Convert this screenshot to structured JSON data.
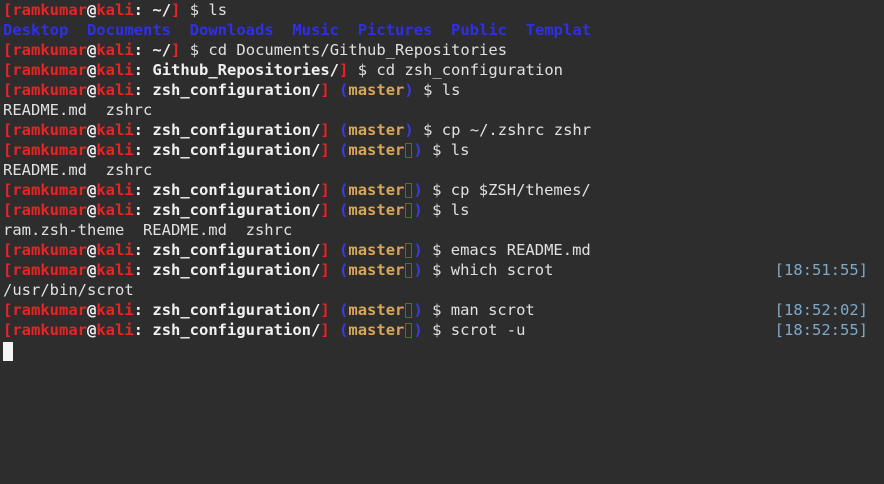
{
  "prompt": {
    "user": "ramkumar",
    "at": "@",
    "host": "kali",
    "colon": ":",
    "open_bracket": "[",
    "close_bracket": "]",
    "dollar": "$"
  },
  "lines": [
    {
      "type": "prompt",
      "path": "~/",
      "branch": "",
      "dirty": false,
      "command": "ls",
      "timestamp": ""
    },
    {
      "type": "dirs",
      "items": [
        "Desktop",
        "Documents",
        "Downloads",
        "Music",
        "Pictures",
        "Public",
        "Templat"
      ]
    },
    {
      "type": "prompt",
      "path": "~/",
      "branch": "",
      "dirty": false,
      "command": "cd Documents/Github_Repositories",
      "timestamp": ""
    },
    {
      "type": "prompt",
      "path": "Github_Repositories/",
      "branch": "",
      "dirty": false,
      "command": "cd zsh_configuration",
      "timestamp": ""
    },
    {
      "type": "prompt",
      "path": "zsh_configuration/",
      "branch": "master",
      "dirty": false,
      "command": "ls",
      "timestamp": ""
    },
    {
      "type": "output",
      "text": "README.md  zshrc"
    },
    {
      "type": "prompt",
      "path": "zsh_configuration/",
      "branch": "master",
      "dirty": false,
      "command": "cp ~/.zshrc zshr",
      "timestamp": ""
    },
    {
      "type": "prompt",
      "path": "zsh_configuration/",
      "branch": "master",
      "dirty": true,
      "command": "ls",
      "timestamp": ""
    },
    {
      "type": "output",
      "text": "README.md  zshrc"
    },
    {
      "type": "prompt",
      "path": "zsh_configuration/",
      "branch": "master",
      "dirty": true,
      "command": "cp $ZSH/themes/",
      "timestamp": ""
    },
    {
      "type": "prompt",
      "path": "zsh_configuration/",
      "branch": "master",
      "dirty": true,
      "command": "ls",
      "timestamp": ""
    },
    {
      "type": "output",
      "text": "ram.zsh-theme  README.md  zshrc"
    },
    {
      "type": "prompt",
      "path": "zsh_configuration/",
      "branch": "master",
      "dirty": true,
      "command": "emacs README.md",
      "timestamp": ""
    },
    {
      "type": "prompt",
      "path": "zsh_configuration/",
      "branch": "master",
      "dirty": true,
      "command": "which scrot",
      "timestamp": "[18:51:55]"
    },
    {
      "type": "output",
      "text": "/usr/bin/scrot"
    },
    {
      "type": "prompt",
      "path": "zsh_configuration/",
      "branch": "master",
      "dirty": true,
      "command": "man scrot",
      "timestamp": "[18:52:02]"
    },
    {
      "type": "prompt",
      "path": "zsh_configuration/",
      "branch": "master",
      "dirty": true,
      "command": "scrot -u",
      "timestamp": "[18:52:55]"
    }
  ],
  "colors": {
    "background": "#2d2d2d",
    "user_host": "#e82424",
    "branch": "#d7a75a",
    "paren": "#3a3ae0",
    "directory": "#2f2fe8",
    "timestamp": "#7fa9c8"
  }
}
